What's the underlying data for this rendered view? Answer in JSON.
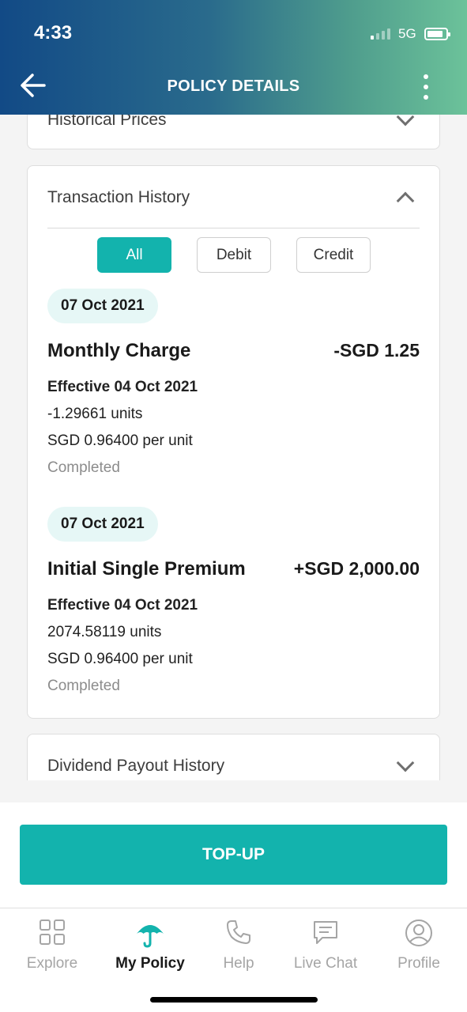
{
  "status_bar": {
    "time": "4:33",
    "network": "5G"
  },
  "header": {
    "title": "POLICY DETAILS"
  },
  "sections": {
    "historical_prices": {
      "title": "Historical Prices"
    },
    "transaction_history": {
      "title": "Transaction History",
      "filters": [
        {
          "label": "All",
          "active": true
        },
        {
          "label": "Debit",
          "active": false
        },
        {
          "label": "Credit",
          "active": false
        }
      ],
      "transactions": [
        {
          "date": "07 Oct 2021",
          "title": "Monthly Charge",
          "amount": "-SGD 1.25",
          "effective": "Effective 04 Oct 2021",
          "units": "-1.29661 units",
          "price": "SGD 0.96400 per unit",
          "status": "Completed"
        },
        {
          "date": "07 Oct 2021",
          "title": "Initial Single Premium",
          "amount": "+SGD 2,000.00",
          "effective": "Effective 04 Oct 2021",
          "units": "2074.58119 units",
          "price": "SGD 0.96400 per unit",
          "status": "Completed"
        }
      ]
    },
    "dividend_payout_history": {
      "title": "Dividend Payout History"
    }
  },
  "footer": {
    "topup_label": "TOP-UP"
  },
  "tabbar": {
    "items": [
      {
        "label": "Explore",
        "icon": "grid-icon"
      },
      {
        "label": "My Policy",
        "icon": "umbrella-icon",
        "active": true
      },
      {
        "label": "Help",
        "icon": "phone-icon"
      },
      {
        "label": "Live Chat",
        "icon": "chat-icon"
      },
      {
        "label": "Profile",
        "icon": "profile-icon"
      }
    ]
  },
  "colors": {
    "accent": "#13b3ad",
    "header_start": "#124a86",
    "header_end": "#6cc29a",
    "date_pill_bg": "#e6f7f6"
  }
}
